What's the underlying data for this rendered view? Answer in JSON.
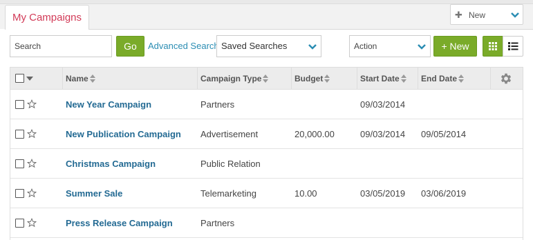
{
  "tabs": {
    "active_label": "My Campaigns"
  },
  "new_menu": {
    "label": "New"
  },
  "toolbar": {
    "search_placeholder": "Search",
    "go_label": "Go",
    "advanced_search_label": "Advanced Search",
    "saved_searches_label": "Saved Searches",
    "action_label": "Action",
    "new_button_label": "+ New"
  },
  "table": {
    "columns": [
      "Name",
      "Campaign Type",
      "Budget",
      "Start Date",
      "End Date"
    ],
    "rows": [
      {
        "name": "New Year Campaign",
        "type": "Partners",
        "budget": "",
        "start": "09/03/2014",
        "end": ""
      },
      {
        "name": "New Publication Campaign",
        "type": "Advertisement",
        "budget": "20,000.00",
        "start": "09/03/2014",
        "end": "09/05/2014"
      },
      {
        "name": "Christmas Campaign",
        "type": "Public Relation",
        "budget": "",
        "start": "",
        "end": ""
      },
      {
        "name": "Summer Sale",
        "type": "Telemarketing",
        "budget": "10.00",
        "start": "03/05/2019",
        "end": "03/06/2019"
      },
      {
        "name": "Press Release Campaign",
        "type": "Partners",
        "budget": "",
        "start": "",
        "end": ""
      }
    ]
  },
  "colors": {
    "accent_green": "#7aab29",
    "tab_red": "#d23a57",
    "link_blue": "#236a93",
    "chevron_teal": "#2b8db3"
  }
}
